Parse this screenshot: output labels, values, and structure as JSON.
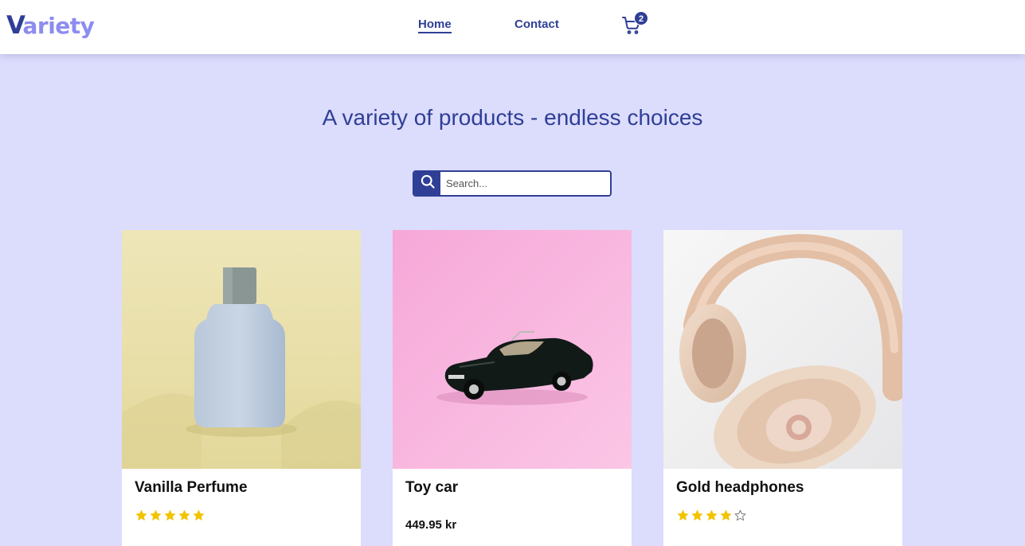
{
  "brand": {
    "logo_initial": "V",
    "logo_rest": "ariety"
  },
  "nav": {
    "home": "Home",
    "contact": "Contact",
    "cart_count": "2"
  },
  "hero": {
    "headline": "A variety of products - endless choices",
    "search_placeholder": "Search..."
  },
  "products": [
    {
      "title": "Vanilla Perfume",
      "rating": 5,
      "max_rating": 5
    },
    {
      "title": "Toy car",
      "price": "449.95 kr"
    },
    {
      "title": "Gold headphones",
      "rating": 4,
      "max_rating": 5
    }
  ],
  "colors": {
    "page_bg": "#dcdcfd",
    "primary": "#2f3f96",
    "logo_accent": "#8c8cf0",
    "star": "#f2c400"
  },
  "icons": [
    "cart-icon",
    "search-icon",
    "star-icon"
  ]
}
